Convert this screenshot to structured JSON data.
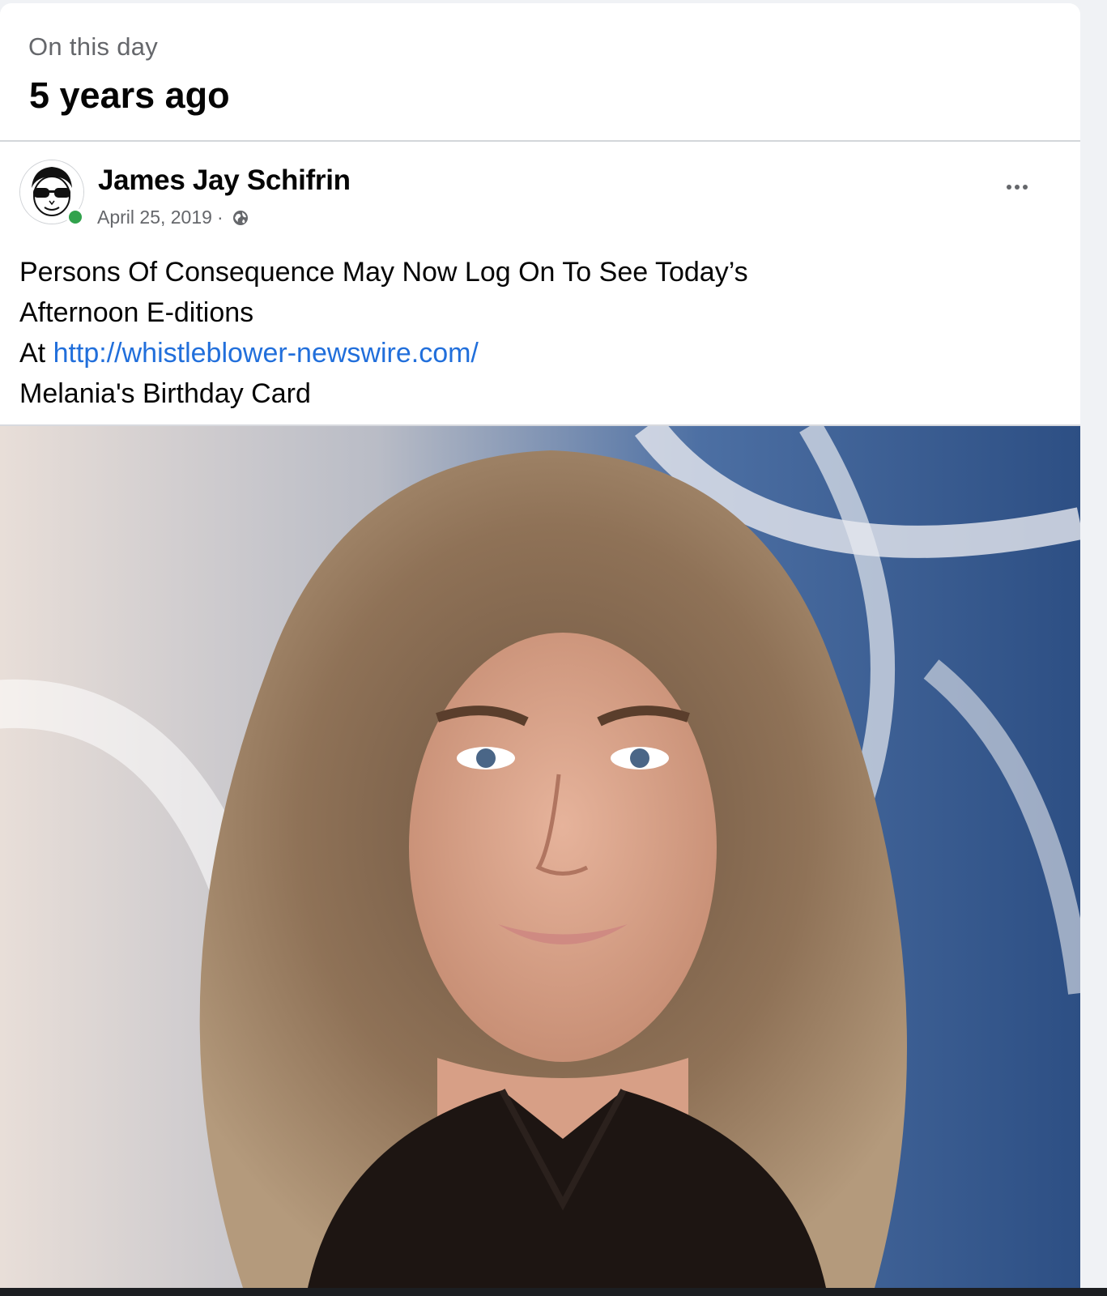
{
  "memory": {
    "eyebrow": "On this day",
    "title": "5 years ago"
  },
  "post": {
    "author": "James Jay Schifrin",
    "date": "April 25, 2019",
    "separator": "·",
    "privacy_icon": "globe-icon",
    "more_icon": "more-options-icon",
    "text_line_1": "Persons Of Consequence May Now Log On To See Today’s",
    "text_line_2": "Afternoon E-ditions",
    "text_line_3_prefix": "At ",
    "link": "http://whistleblower-newswire.com/",
    "text_line_4": "Melania's Birthday Card"
  },
  "colors": {
    "link": "#216fdb",
    "online": "#31a24c",
    "secondary_text": "#65676b"
  }
}
